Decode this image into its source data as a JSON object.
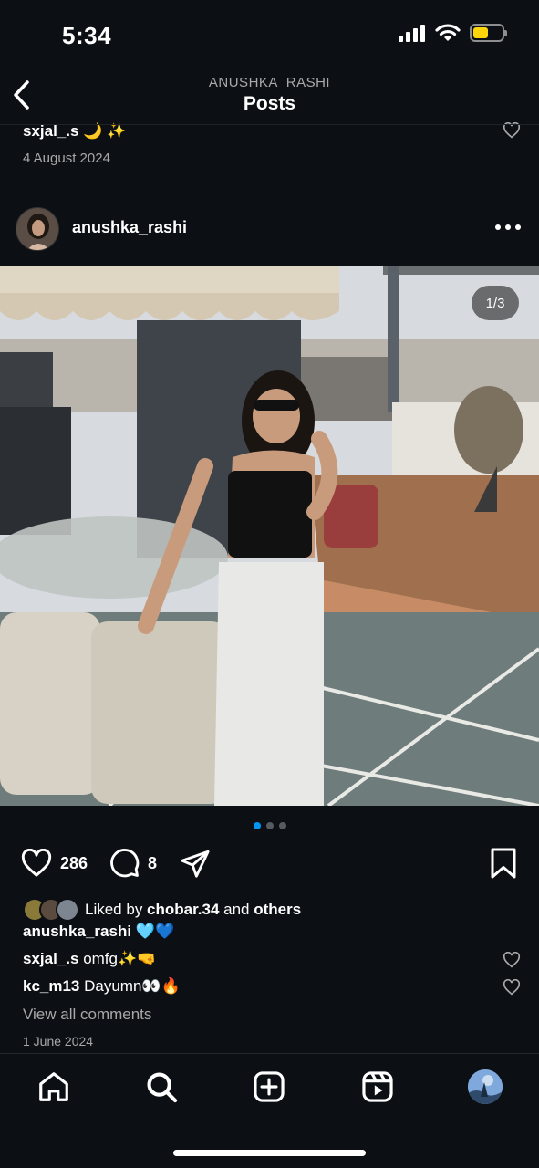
{
  "status_bar": {
    "time": "5:34",
    "icons": [
      "signal-icon",
      "wifi-icon",
      "battery-icon"
    ],
    "battery_color": "#ffd60a"
  },
  "header": {
    "subtitle": "ANUSHKA_RASHI",
    "title": "Posts",
    "back_icon": "chevron-left-icon"
  },
  "previous_post": {
    "username": "sxjal_.s",
    "emoji": "🌙 ✨",
    "date": "4 August 2024"
  },
  "post": {
    "username": "anushka_rashi",
    "media_counter": "1/3",
    "carousel": {
      "count": 3,
      "active": 0
    },
    "likes": "286",
    "comments_count": "8",
    "liked_by": {
      "prefix": "Liked by ",
      "user": "chobar.34",
      "middle": " and ",
      "others": "others"
    },
    "caption": {
      "username": "anushka_rashi",
      "text": "🩵💙"
    },
    "comments": [
      {
        "username": "sxjal_.s",
        "text": "omfg✨🤜"
      },
      {
        "username": "kc_m13",
        "text": "Dayumn👀🔥"
      }
    ],
    "view_all": "View all comments",
    "date": "1 June 2024"
  },
  "tabs": [
    "home-icon",
    "search-icon",
    "create-icon",
    "reels-icon",
    "profile-avatar"
  ],
  "colors": {
    "background": "#0c1014",
    "accent": "#0095f6",
    "secondary_text": "#a8a8a8"
  }
}
